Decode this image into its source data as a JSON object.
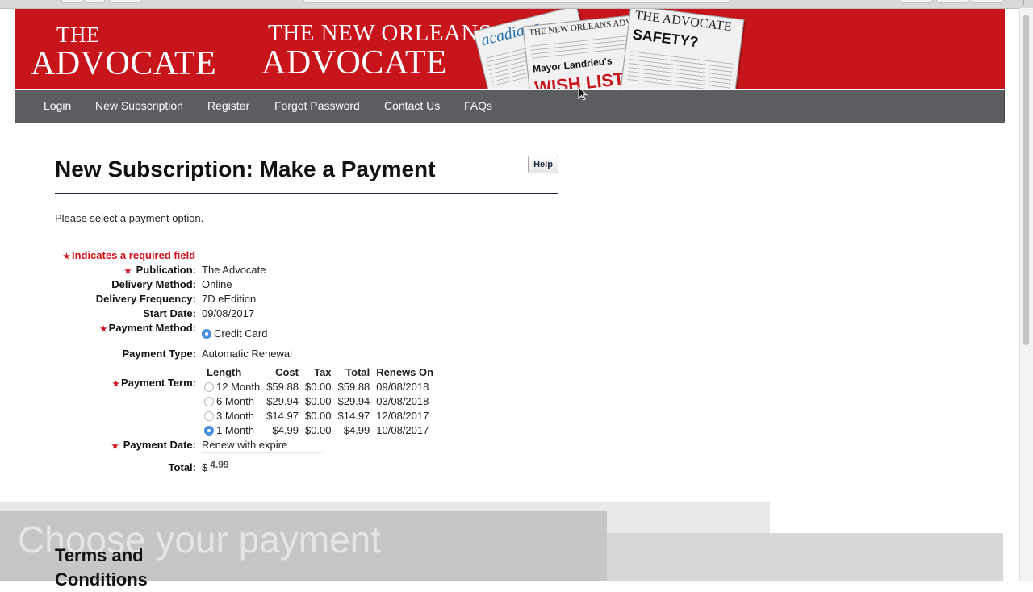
{
  "banner": {
    "logo1_small": "THE",
    "logo1_big": "ADVOCATE",
    "logo2_small": "THE NEW ORLEANS",
    "logo2_big": "ADVOCATE",
    "paper1_mast": "acadiana",
    "paper2_mast": "THE NEW ORLEANS ADVOCATE",
    "paper2_head": "Mayor Landrieu's",
    "paper2_head2": "WISH LIST:",
    "paper3_mast": "THE ADVOCATE",
    "paper3_head": "SAFETY?",
    "accent_color": "#c8141b"
  },
  "nav": {
    "items": [
      "Login",
      "New Subscription",
      "Register",
      "Forgot Password",
      "Contact Us",
      "FAQs"
    ]
  },
  "page": {
    "title": "New Subscription: Make a Payment",
    "help_label": "Help",
    "instructions": "Please select a payment option.",
    "required_note": "Indicates a required field"
  },
  "form": {
    "publication_label": "Publication:",
    "publication_value": "The Advocate",
    "delivery_method_label": "Delivery Method:",
    "delivery_method_value": "Online",
    "delivery_frequency_label": "Delivery Frequency:",
    "delivery_frequency_value": "7D eEdition",
    "start_date_label": "Start Date:",
    "start_date_value": "09/08/2017",
    "payment_method_label": "Payment Method:",
    "payment_method_value": "Credit Card",
    "payment_type_label": "Payment Type:",
    "payment_type_value": "Automatic Renewal",
    "payment_term_label": "Payment Term:",
    "term_headers": [
      "Length",
      "Cost",
      "Tax",
      "Total",
      "Renews On"
    ],
    "terms": [
      {
        "length": "12 Month",
        "cost": "$59.88",
        "tax": "$0.00",
        "total": "$59.88",
        "renews": "09/08/2018",
        "selected": false
      },
      {
        "length": "6 Month",
        "cost": "$29.94",
        "tax": "$0.00",
        "total": "$29.94",
        "renews": "03/08/2018",
        "selected": false
      },
      {
        "length": "3 Month",
        "cost": "$14.97",
        "tax": "$0.00",
        "total": "$14.97",
        "renews": "12/08/2017",
        "selected": false
      },
      {
        "length": "1 Month",
        "cost": "$4.99",
        "tax": "$0.00",
        "total": "$4.99",
        "renews": "10/08/2017",
        "selected": true
      }
    ],
    "payment_date_label": "Payment Date:",
    "payment_date_value": "Renew with expire",
    "total_label": "Total:",
    "total_currency": "$",
    "total_amount": "4.99"
  },
  "overlay": {
    "caption": "Choose your payment",
    "terms_title": "Terms and Conditions"
  }
}
